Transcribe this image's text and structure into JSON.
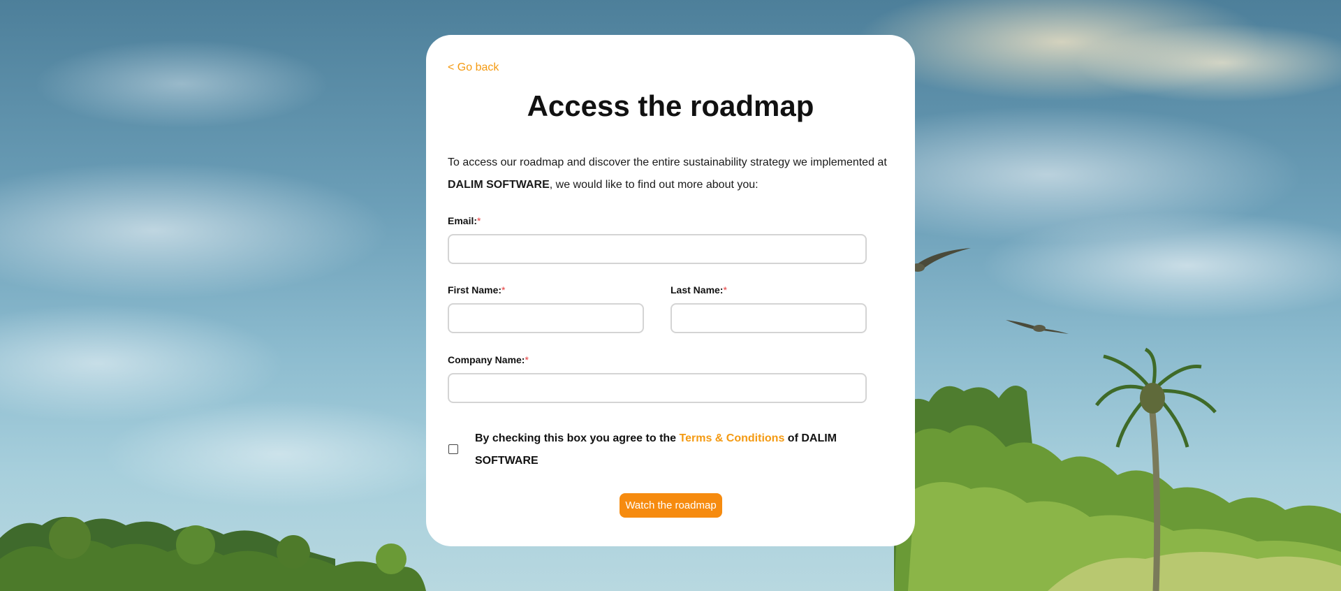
{
  "back_link": "< Go back",
  "title": "Access the roadmap",
  "intro": {
    "part1": "To access our roadmap and discover the entire sustainability strategy we implemented at ",
    "company": "DALIM SOFTWARE",
    "part2": ", we would like to find out more about you:"
  },
  "form": {
    "email_label": "Email:",
    "first_name_label": "First Name:",
    "last_name_label": "Last Name:",
    "company_label": "Company Name:",
    "required_mark": "*",
    "email_value": "",
    "first_name_value": "",
    "last_name_value": "",
    "company_value": ""
  },
  "consent": {
    "prefix": "By checking this box you agree to the ",
    "link": "Terms & Conditions",
    "suffix": " of DALIM SOFTWARE",
    "checked": false
  },
  "submit_label": "Watch the roadmap",
  "colors": {
    "accent": "#f49a12",
    "button": "#f68b0f",
    "required": "#e53c3c"
  }
}
